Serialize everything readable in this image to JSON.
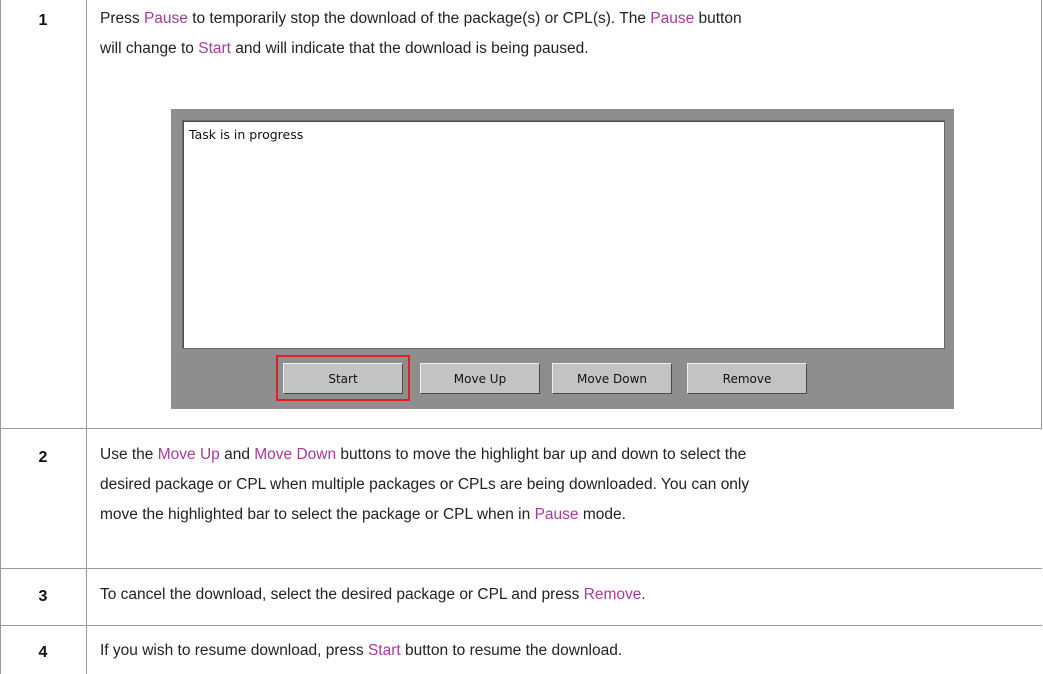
{
  "steps": [
    {
      "number": "1",
      "lines": [
        [
          {
            "t": "Press ",
            "h": false
          },
          {
            "t": "Pause",
            "h": true
          },
          {
            "t": " to temporarily stop the download of the package(s) or CPL(s). The ",
            "h": false
          },
          {
            "t": "Pause",
            "h": true
          },
          {
            "t": " button",
            "h": false
          }
        ],
        [
          {
            "t": "will change to ",
            "h": false
          },
          {
            "t": "Start",
            "h": true
          },
          {
            "t": " and will indicate that the download is being paused.",
            "h": false
          }
        ]
      ]
    },
    {
      "number": "2",
      "lines": [
        [
          {
            "t": "Use the ",
            "h": false
          },
          {
            "t": "Move Up",
            "h": true
          },
          {
            "t": " and ",
            "h": false
          },
          {
            "t": "Move Down",
            "h": true
          },
          {
            "t": " buttons to move the highlight bar up and down to select the",
            "h": false
          }
        ],
        [
          {
            "t": "desired package or CPL when multiple packages or CPLs are being downloaded. You can only",
            "h": false
          }
        ],
        [
          {
            "t": "move the highlighted bar to select the package or CPL when in ",
            "h": false
          },
          {
            "t": "Pause",
            "h": true
          },
          {
            "t": " mode.",
            "h": false
          }
        ]
      ]
    },
    {
      "number": "3",
      "lines": [
        [
          {
            "t": "To cancel the download, select the desired package or CPL and press ",
            "h": false
          },
          {
            "t": "Remove",
            "h": true
          },
          {
            "t": ".",
            "h": false
          }
        ]
      ]
    },
    {
      "number": "4",
      "lines": [
        [
          {
            "t": "If you wish to resume download, press ",
            "h": false
          },
          {
            "t": "Start",
            "h": true
          },
          {
            "t": " button to resume the download.",
            "h": false
          }
        ]
      ]
    }
  ],
  "screenshot": {
    "status_text": "Task is in progress",
    "buttons": {
      "start": "Start",
      "move_up": "Move Up",
      "move_down": "Move Down",
      "remove": "Remove"
    },
    "highlighted_button": "start"
  },
  "colors": {
    "highlight_text": "#a43c9a",
    "rule": "#9a9a9a",
    "callout": "#e02020"
  }
}
